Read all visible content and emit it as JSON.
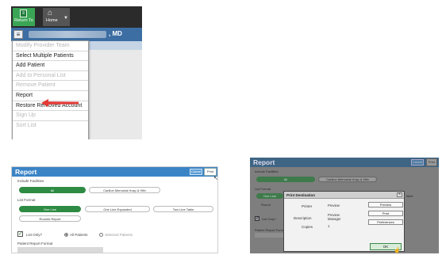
{
  "panel1": {
    "return_to_label": "Return To",
    "home_label": "Home",
    "patient_suffix": ", MD",
    "menu_items": [
      {
        "label": "Modify Provider Team",
        "enabled": false
      },
      {
        "label": "Select Multiple Patients",
        "enabled": true
      },
      {
        "label": "Add Patient",
        "enabled": true
      },
      {
        "label": "Add to Personal List",
        "enabled": false
      },
      {
        "label": "Remove Patient",
        "enabled": false
      },
      {
        "label": "Report",
        "enabled": true,
        "highlighted_by_arrow": true
      },
      {
        "label": "Restore Removed Account",
        "enabled": true
      },
      {
        "label": "Sign Up",
        "enabled": false
      },
      {
        "label": "Sort List",
        "enabled": false
      }
    ],
    "arrow_color": "#e53935"
  },
  "panel2": {
    "title": "Report",
    "cancel_label": "Cancel",
    "print_label": "Print",
    "include_facilities_label": "Include Facilities",
    "facility_options": [
      "All",
      "Carilion Memorial Hosp & Hlth"
    ],
    "list_format_label": "List Format",
    "list_format_options": [
      "One Line",
      "One Line Expanded",
      "Two Line Table"
    ],
    "rounds_report_label": "Rounds Report",
    "list_only_label": "List Only?",
    "list_only_checked": true,
    "patient_scope_options": [
      "All Patients",
      "Selected Patients"
    ],
    "patient_scope_selected": "All Patients",
    "patient_report_format_label": "Patient Report Format",
    "accent_color": "#3a84c6",
    "selected_color": "#2e8b43"
  },
  "panel3": {
    "title": "Report",
    "cancel_label": "Cancel",
    "print_label": "Print",
    "include_facilities_label": "Include Facilities",
    "facility_options": [
      "All",
      "Carilion Memorial Hosp & Hlth"
    ],
    "list_format_label": "List Format",
    "list_format_option_visible": "One Line",
    "facility_option_partial": "Table",
    "rounds_label_partial": "Round",
    "list_only_label": "List Only?",
    "patient_report_format_label": "Patient Report Form",
    "dialog": {
      "title": "Print Destination",
      "printer_label": "Printer",
      "printer_value": "Preview",
      "description_label": "Description",
      "description_value_line1": "Preview",
      "description_value_line2": "Manager",
      "copies_label": "Copies",
      "copies_value": "1",
      "buttons": [
        "Preview",
        "Print",
        "Preferences"
      ],
      "ok_label": "OK"
    }
  }
}
